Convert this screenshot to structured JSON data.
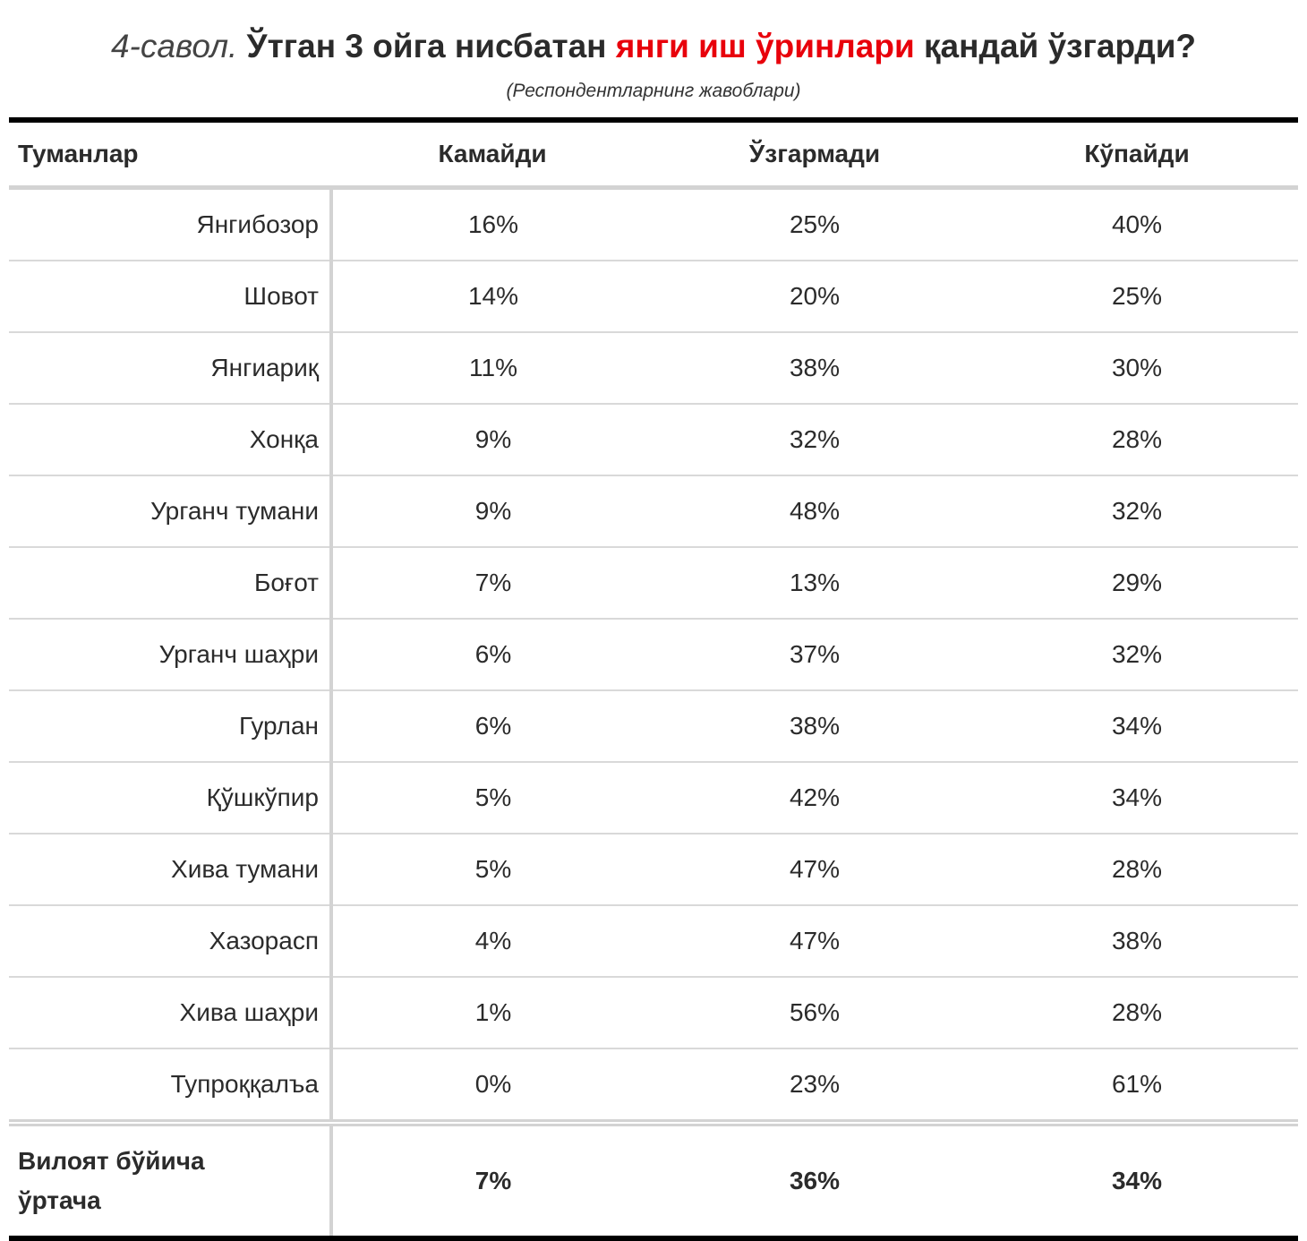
{
  "title": {
    "number": "4-савол.",
    "main_before": "Ўтган 3 ойга нисбатан",
    "highlight": "янги иш ўринлари",
    "main_after": "қандай ўзгарди?",
    "subtitle": "(Респондентларнинг жавоблари)"
  },
  "colors": {
    "highlight": "#e8000b",
    "text": "#2b2b2b",
    "rule": "#000000",
    "grid": "#d3d3d3"
  },
  "table": {
    "headers": [
      "Туманлар",
      "Камайди",
      "Ўзгармади",
      "Кўпайди"
    ],
    "rows": [
      [
        "Янгибозор",
        "16%",
        "25%",
        "40%"
      ],
      [
        "Шовот",
        "14%",
        "20%",
        "25%"
      ],
      [
        "Янгиариқ",
        "11%",
        "38%",
        "30%"
      ],
      [
        "Хонқа",
        "9%",
        "32%",
        "28%"
      ],
      [
        "Урганч тумани",
        "9%",
        "48%",
        "32%"
      ],
      [
        "Боғот",
        "7%",
        "13%",
        "29%"
      ],
      [
        "Урганч шаҳри",
        "6%",
        "37%",
        "32%"
      ],
      [
        "Гурлан",
        "6%",
        "38%",
        "34%"
      ],
      [
        "Қўшкўпир",
        "5%",
        "42%",
        "34%"
      ],
      [
        "Хива тумани",
        "5%",
        "47%",
        "28%"
      ],
      [
        "Хазорасп",
        "4%",
        "47%",
        "38%"
      ],
      [
        "Хива шаҳри",
        "1%",
        "56%",
        "28%"
      ],
      [
        "Тупроққалъа",
        "0%",
        "23%",
        "61%"
      ]
    ],
    "total": {
      "label_line1": "Вилоят бўйича",
      "label_line2": "ўртача",
      "values": [
        "7%",
        "36%",
        "34%"
      ]
    }
  }
}
